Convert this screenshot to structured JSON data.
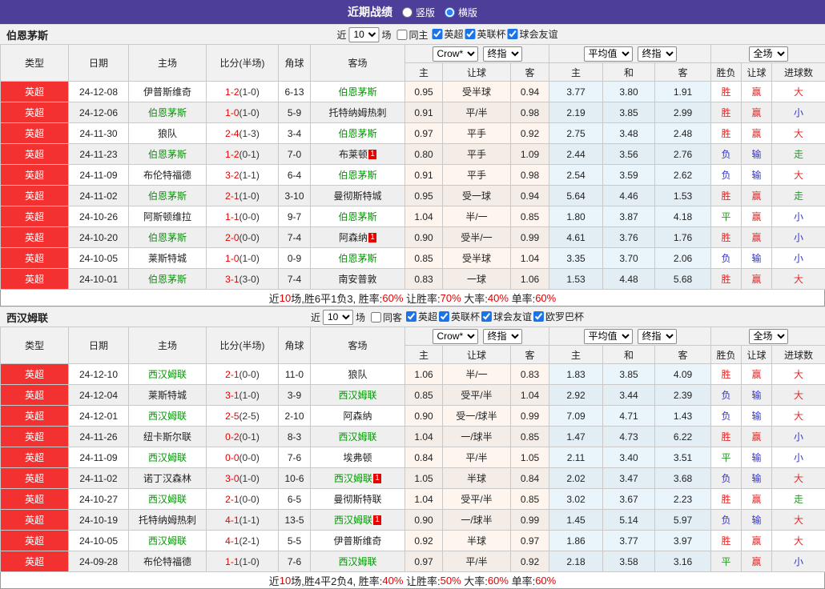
{
  "titlebar": {
    "title": "近期战绩",
    "options": [
      {
        "label": "竖版",
        "selected": false
      },
      {
        "label": "横版",
        "selected": true
      }
    ]
  },
  "controls": {
    "near_label": "近",
    "games_count": "10",
    "games_label": "场"
  },
  "table": {
    "selects": {
      "bookmaker": "Crow*",
      "final": "终指",
      "average": "平均值",
      "final2": "终指",
      "fulltime": "全场"
    },
    "columns": [
      "类型",
      "日期",
      "主场",
      "比分(半场)",
      "角球",
      "客场"
    ],
    "sub_columns": [
      "主",
      "让球",
      "客",
      "主",
      "和",
      "客",
      "胜负",
      "让球",
      "进球数"
    ]
  },
  "result_colors": {
    "胜": "red",
    "平": "green",
    "负": "blue",
    "赢": "red",
    "输": "blue",
    "大": "red",
    "小": "blue",
    "走": "green"
  },
  "colors": {
    "accent": "#4c3e99",
    "league_bg": "#f43131",
    "score_red": "#e60000",
    "team_green": "#009900",
    "win_red": "#dd2c2c",
    "lose_blue": "#3232cc",
    "draw_green": "#2a9a2a"
  },
  "sections": [
    {
      "team": "伯恩茅斯",
      "filter": {
        "same_label": "同主",
        "same_checked": false,
        "leagues": [
          "英超",
          "英联杯",
          "球会友谊"
        ]
      },
      "rows": [
        {
          "league": "英超",
          "date": "24-12-08",
          "home": "伊普斯维奇",
          "home_hl": false,
          "home_badge": "",
          "score": "1-2",
          "half": "(1-0)",
          "corners": "6-13",
          "away": "伯恩茅斯",
          "away_hl": true,
          "away_badge": "",
          "odds": [
            "0.95",
            "受半球",
            "0.94"
          ],
          "avg": [
            "3.77",
            "3.80",
            "1.91"
          ],
          "result": [
            "胜",
            "赢",
            "大"
          ]
        },
        {
          "league": "英超",
          "date": "24-12-06",
          "home": "伯恩茅斯",
          "home_hl": true,
          "home_badge": "",
          "score": "1-0",
          "half": "(1-0)",
          "corners": "5-9",
          "away": "托特纳姆热刺",
          "away_hl": false,
          "away_badge": "",
          "odds": [
            "0.91",
            "平/半",
            "0.98"
          ],
          "avg": [
            "2.19",
            "3.85",
            "2.99"
          ],
          "result": [
            "胜",
            "赢",
            "小"
          ]
        },
        {
          "league": "英超",
          "date": "24-11-30",
          "home": "狼队",
          "home_hl": false,
          "home_badge": "",
          "score": "2-4",
          "half": "(1-3)",
          "corners": "3-4",
          "away": "伯恩茅斯",
          "away_hl": true,
          "away_badge": "",
          "odds": [
            "0.97",
            "平手",
            "0.92"
          ],
          "avg": [
            "2.75",
            "3.48",
            "2.48"
          ],
          "result": [
            "胜",
            "赢",
            "大"
          ]
        },
        {
          "league": "英超",
          "date": "24-11-23",
          "home": "伯恩茅斯",
          "home_hl": true,
          "home_badge": "",
          "score": "1-2",
          "half": "(0-1)",
          "corners": "7-0",
          "away": "布莱顿",
          "away_hl": false,
          "away_badge": "1",
          "odds": [
            "0.80",
            "平手",
            "1.09"
          ],
          "avg": [
            "2.44",
            "3.56",
            "2.76"
          ],
          "result": [
            "负",
            "输",
            "走"
          ]
        },
        {
          "league": "英超",
          "date": "24-11-09",
          "home": "布伦特福德",
          "home_hl": false,
          "home_badge": "",
          "score": "3-2",
          "half": "(1-1)",
          "corners": "6-4",
          "away": "伯恩茅斯",
          "away_hl": true,
          "away_badge": "",
          "odds": [
            "0.91",
            "平手",
            "0.98"
          ],
          "avg": [
            "2.54",
            "3.59",
            "2.62"
          ],
          "result": [
            "负",
            "输",
            "大"
          ]
        },
        {
          "league": "英超",
          "date": "24-11-02",
          "home": "伯恩茅斯",
          "home_hl": true,
          "home_badge": "",
          "score": "2-1",
          "half": "(1-0)",
          "corners": "3-10",
          "away": "曼彻斯特城",
          "away_hl": false,
          "away_badge": "",
          "odds": [
            "0.95",
            "受一球",
            "0.94"
          ],
          "avg": [
            "5.64",
            "4.46",
            "1.53"
          ],
          "result": [
            "胜",
            "赢",
            "走"
          ]
        },
        {
          "league": "英超",
          "date": "24-10-26",
          "home": "阿斯顿维拉",
          "home_hl": false,
          "home_badge": "",
          "score": "1-1",
          "half": "(0-0)",
          "corners": "9-7",
          "away": "伯恩茅斯",
          "away_hl": true,
          "away_badge": "",
          "odds": [
            "1.04",
            "半/一",
            "0.85"
          ],
          "avg": [
            "1.80",
            "3.87",
            "4.18"
          ],
          "result": [
            "平",
            "赢",
            "小"
          ]
        },
        {
          "league": "英超",
          "date": "24-10-20",
          "home": "伯恩茅斯",
          "home_hl": true,
          "home_badge": "",
          "score": "2-0",
          "half": "(0-0)",
          "corners": "7-4",
          "away": "阿森纳",
          "away_hl": false,
          "away_badge": "1",
          "odds": [
            "0.90",
            "受半/一",
            "0.99"
          ],
          "avg": [
            "4.61",
            "3.76",
            "1.76"
          ],
          "result": [
            "胜",
            "赢",
            "小"
          ]
        },
        {
          "league": "英超",
          "date": "24-10-05",
          "home": "莱斯特城",
          "home_hl": false,
          "home_badge": "",
          "score": "1-0",
          "half": "(1-0)",
          "corners": "0-9",
          "away": "伯恩茅斯",
          "away_hl": true,
          "away_badge": "",
          "odds": [
            "0.85",
            "受半球",
            "1.04"
          ],
          "avg": [
            "3.35",
            "3.70",
            "2.06"
          ],
          "result": [
            "负",
            "输",
            "小"
          ]
        },
        {
          "league": "英超",
          "date": "24-10-01",
          "home": "伯恩茅斯",
          "home_hl": true,
          "home_badge": "",
          "score": "3-1",
          "half": "(3-0)",
          "corners": "7-4",
          "away": "南安普敦",
          "away_hl": false,
          "away_badge": "",
          "odds": [
            "0.83",
            "一球",
            "1.06"
          ],
          "avg": [
            "1.53",
            "4.48",
            "5.68"
          ],
          "result": [
            "胜",
            "赢",
            "大"
          ]
        }
      ],
      "summary": [
        {
          "t": "近"
        },
        {
          "t": "10",
          "r": 1
        },
        {
          "t": "场,胜6平1负3, 胜率:"
        },
        {
          "t": "60%",
          "r": 1
        },
        {
          "t": " 让胜率:"
        },
        {
          "t": "70%",
          "r": 1
        },
        {
          "t": " 大率:"
        },
        {
          "t": "40%",
          "r": 1
        },
        {
          "t": " 单率:"
        },
        {
          "t": "60%",
          "r": 1
        }
      ]
    },
    {
      "team": "西汉姆联",
      "filter": {
        "same_label": "同客",
        "same_checked": false,
        "leagues": [
          "英超",
          "英联杯",
          "球会友谊",
          "欧罗巴杯"
        ]
      },
      "rows": [
        {
          "league": "英超",
          "date": "24-12-10",
          "home": "西汉姆联",
          "home_hl": true,
          "home_badge": "",
          "score": "2-1",
          "half": "(0-0)",
          "corners": "11-0",
          "away": "狼队",
          "away_hl": false,
          "away_badge": "",
          "odds": [
            "1.06",
            "半/一",
            "0.83"
          ],
          "avg": [
            "1.83",
            "3.85",
            "4.09"
          ],
          "result": [
            "胜",
            "赢",
            "大"
          ]
        },
        {
          "league": "英超",
          "date": "24-12-04",
          "home": "莱斯特城",
          "home_hl": false,
          "home_badge": "",
          "score": "3-1",
          "half": "(1-0)",
          "corners": "3-9",
          "away": "西汉姆联",
          "away_hl": true,
          "away_badge": "",
          "odds": [
            "0.85",
            "受平/半",
            "1.04"
          ],
          "avg": [
            "2.92",
            "3.44",
            "2.39"
          ],
          "result": [
            "负",
            "输",
            "大"
          ]
        },
        {
          "league": "英超",
          "date": "24-12-01",
          "home": "西汉姆联",
          "home_hl": true,
          "home_badge": "",
          "score": "2-5",
          "half": "(2-5)",
          "corners": "2-10",
          "away": "阿森纳",
          "away_hl": false,
          "away_badge": "",
          "odds": [
            "0.90",
            "受一/球半",
            "0.99"
          ],
          "avg": [
            "7.09",
            "4.71",
            "1.43"
          ],
          "result": [
            "负",
            "输",
            "大"
          ]
        },
        {
          "league": "英超",
          "date": "24-11-26",
          "home": "纽卡斯尔联",
          "home_hl": false,
          "home_badge": "",
          "score": "0-2",
          "half": "(0-1)",
          "corners": "8-3",
          "away": "西汉姆联",
          "away_hl": true,
          "away_badge": "",
          "odds": [
            "1.04",
            "一/球半",
            "0.85"
          ],
          "avg": [
            "1.47",
            "4.73",
            "6.22"
          ],
          "result": [
            "胜",
            "赢",
            "小"
          ]
        },
        {
          "league": "英超",
          "date": "24-11-09",
          "home": "西汉姆联",
          "home_hl": true,
          "home_badge": "",
          "score": "0-0",
          "half": "(0-0)",
          "corners": "7-6",
          "away": "埃弗顿",
          "away_hl": false,
          "away_badge": "",
          "odds": [
            "0.84",
            "平/半",
            "1.05"
          ],
          "avg": [
            "2.11",
            "3.40",
            "3.51"
          ],
          "result": [
            "平",
            "输",
            "小"
          ]
        },
        {
          "league": "英超",
          "date": "24-11-02",
          "home": "诺丁汉森林",
          "home_hl": false,
          "home_badge": "",
          "score": "3-0",
          "half": "(1-0)",
          "corners": "10-6",
          "away": "西汉姆联",
          "away_hl": true,
          "away_badge": "1",
          "odds": [
            "1.05",
            "半球",
            "0.84"
          ],
          "avg": [
            "2.02",
            "3.47",
            "3.68"
          ],
          "result": [
            "负",
            "输",
            "大"
          ]
        },
        {
          "league": "英超",
          "date": "24-10-27",
          "home": "西汉姆联",
          "home_hl": true,
          "home_badge": "",
          "score": "2-1",
          "half": "(0-0)",
          "corners": "6-5",
          "away": "曼彻斯特联",
          "away_hl": false,
          "away_badge": "",
          "odds": [
            "1.04",
            "受平/半",
            "0.85"
          ],
          "avg": [
            "3.02",
            "3.67",
            "2.23"
          ],
          "result": [
            "胜",
            "赢",
            "走"
          ]
        },
        {
          "league": "英超",
          "date": "24-10-19",
          "home": "托特纳姆热刺",
          "home_hl": false,
          "home_badge": "",
          "score": "4-1",
          "half": "(1-1)",
          "corners": "13-5",
          "away": "西汉姆联",
          "away_hl": true,
          "away_badge": "1",
          "odds": [
            "0.90",
            "一/球半",
            "0.99"
          ],
          "avg": [
            "1.45",
            "5.14",
            "5.97"
          ],
          "result": [
            "负",
            "输",
            "大"
          ]
        },
        {
          "league": "英超",
          "date": "24-10-05",
          "home": "西汉姆联",
          "home_hl": true,
          "home_badge": "",
          "score": "4-1",
          "half": "(2-1)",
          "corners": "5-5",
          "away": "伊普斯维奇",
          "away_hl": false,
          "away_badge": "",
          "odds": [
            "0.92",
            "半球",
            "0.97"
          ],
          "avg": [
            "1.86",
            "3.77",
            "3.97"
          ],
          "result": [
            "胜",
            "赢",
            "大"
          ]
        },
        {
          "league": "英超",
          "date": "24-09-28",
          "home": "布伦特福德",
          "home_hl": false,
          "home_badge": "",
          "score": "1-1",
          "half": "(1-0)",
          "corners": "7-6",
          "away": "西汉姆联",
          "away_hl": true,
          "away_badge": "",
          "odds": [
            "0.97",
            "平/半",
            "0.92"
          ],
          "avg": [
            "2.18",
            "3.58",
            "3.16"
          ],
          "result": [
            "平",
            "赢",
            "小"
          ]
        }
      ],
      "summary": [
        {
          "t": "近"
        },
        {
          "t": "10",
          "r": 1
        },
        {
          "t": "场,胜4平2负4, 胜率:"
        },
        {
          "t": "40%",
          "r": 1
        },
        {
          "t": " 让胜率:"
        },
        {
          "t": "50%",
          "r": 1
        },
        {
          "t": " 大率:"
        },
        {
          "t": "60%",
          "r": 1
        },
        {
          "t": " 单率:"
        },
        {
          "t": "60%",
          "r": 1
        }
      ]
    }
  ]
}
